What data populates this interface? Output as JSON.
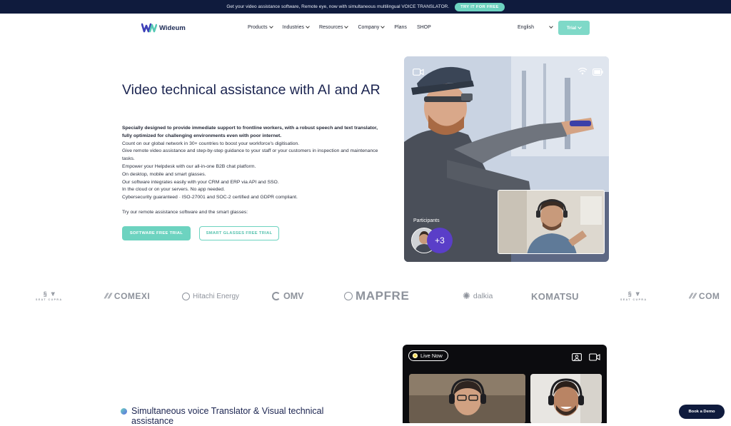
{
  "topbar": {
    "message": "Get your video assistance software, Remote eye, now with simultaneous multilingual VOICE TRANSLATOR.",
    "cta_label": "TRY IT FOR FREE"
  },
  "nav": {
    "logo_text": "Wideum",
    "items": [
      {
        "label": "Products",
        "dropdown": true
      },
      {
        "label": "Industries",
        "dropdown": true
      },
      {
        "label": "Resources",
        "dropdown": true
      },
      {
        "label": "Company",
        "dropdown": true
      },
      {
        "label": "Plans",
        "dropdown": false
      },
      {
        "label": "SHOP",
        "dropdown": false
      }
    ],
    "language": "English",
    "trial_label": "Trial"
  },
  "hero": {
    "title": "Video technical assistance with AI and AR",
    "lead": "Specially designed to provide immediate support to frontline workers, with a robust speech and text translator, fully optimized for challenging environments even with poor internet.",
    "lines": [
      "Count on our global network in 30+ countries to boost your workforce's digitisation.",
      "Give remote video assistance and step-by-step guidance to your staff or your customers in inspection and maintenance tasks.",
      "Empower your Helpdesk with our all-in-one B2B chat platform.",
      "On desktop, mobile and smart glasses.",
      "Our software integrates easily with your CRM and ERP via API and SSO.",
      "In the cloud or on your servers. No app needed.",
      "Cybersecurity guaranteed · ISO-27001 and SOC-2 certified and GDPR compliant."
    ],
    "try_line": "Try our remote assistance software and the smart glasses:",
    "cta_software": "SOFTWARE FREE TRIAL",
    "cta_glasses": "SMART GLASSES FREE TRIAL",
    "participants_label": "Participants",
    "participants_extra": "+3"
  },
  "logos": [
    "SEAT CUPRA",
    "COMEXI",
    "Hitachi Energy",
    "OMV",
    "MAPFRE",
    "dalkia",
    "KOMATSU",
    "SEAT CUPRA",
    "COM"
  ],
  "section2": {
    "title": "Simultaneous voice Translator & Visual technical assistance",
    "live_label": "Live Now"
  },
  "book_demo_label": "Book a Demo",
  "colors": {
    "navy": "#0f1b3d",
    "accent": "#6dd3c0",
    "heading": "#1b2450",
    "purple": "#5a3ec8"
  }
}
